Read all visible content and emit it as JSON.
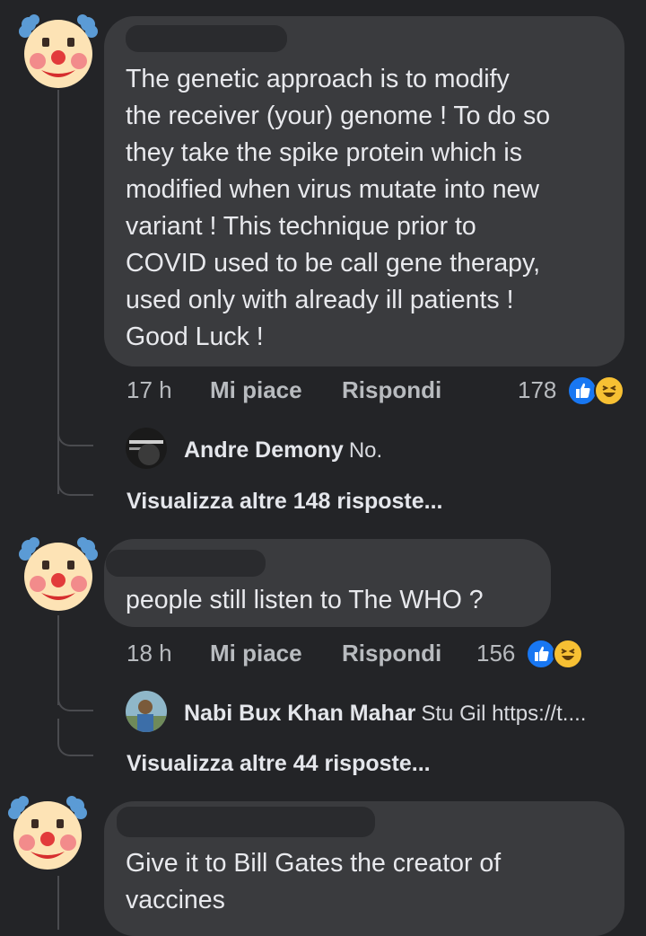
{
  "comments": [
    {
      "text": "The genetic approach is to modify\nthe receiver (your) genome ! To do so\nthey take the spike protein which is\nmodified when virus mutate into new\nvariant ! This technique prior to\nCOVID used to be call gene therapy,\nused only with already ill patients !\nGood Luck !",
      "time": "17 h",
      "like_label": "Mi piace",
      "reply_label": "Rispondi",
      "reaction_count": "178",
      "reactions": [
        "like-icon",
        "haha-icon"
      ],
      "reply": {
        "author": "Andre Demony",
        "text": "No."
      },
      "more_replies": "Visualizza altre 148 risposte..."
    },
    {
      "text": "people still listen to The WHO ?",
      "time": "18 h",
      "like_label": "Mi piace",
      "reply_label": "Rispondi",
      "reaction_count": "156",
      "reactions": [
        "like-icon",
        "haha-icon"
      ],
      "reply": {
        "author": "Nabi Bux Khan Mahar",
        "text": "Stu Gil https://t...."
      },
      "more_replies": "Visualizza altre 44 risposte..."
    },
    {
      "text": "Give it to Bill Gates the creator of\nvaccines"
    }
  ],
  "colors": {
    "background": "#232427",
    "bubble": "#3a3b3e",
    "like_blue": "#1877f2",
    "haha_yellow": "#f7c033"
  }
}
